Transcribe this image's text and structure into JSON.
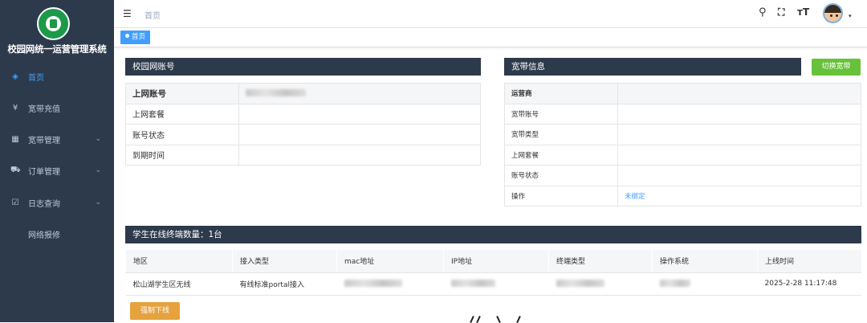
{
  "sidebar": {
    "system_title": "校园网统一运营管理系统",
    "items": [
      {
        "label": "首页",
        "icon": "dashboard-icon",
        "glyph": "◈",
        "active": true,
        "has_arrow": false
      },
      {
        "label": "宽带充值",
        "icon": "yen-icon",
        "glyph": "¥",
        "active": false,
        "has_arrow": false
      },
      {
        "label": "宽带管理",
        "icon": "grid-icon",
        "glyph": "▦",
        "active": false,
        "has_arrow": true
      },
      {
        "label": "订单管理",
        "icon": "cart-icon",
        "glyph": "⛟",
        "active": false,
        "has_arrow": true
      },
      {
        "label": "日志查询",
        "icon": "log-icon",
        "glyph": "☑",
        "active": false,
        "has_arrow": true
      },
      {
        "label": "网络报修",
        "icon": "",
        "glyph": "",
        "active": false,
        "has_arrow": false
      }
    ],
    "arrow": "⌄"
  },
  "topbar": {
    "breadcrumb": "首页",
    "hamburger": "☰",
    "icons": {
      "search": "⚲",
      "fullscreen": "⛶",
      "font_size": "ᴛT"
    },
    "avatar_caret": "▾"
  },
  "tags": {
    "active_tag": "首页"
  },
  "campus_panel": {
    "title": "校园网账号",
    "rows": [
      {
        "label": "上网账号",
        "value_masked": true
      },
      {
        "label": "上网套餐",
        "value": ""
      },
      {
        "label": "账号状态",
        "value": ""
      },
      {
        "label": "到期时间",
        "value": ""
      }
    ]
  },
  "broadband_panel": {
    "title": "宽带信息",
    "switch_button": "切换宽带",
    "rows": [
      {
        "label": "运营商",
        "value": ""
      },
      {
        "label": "宽带账号",
        "value": ""
      },
      {
        "label": "宽带类型",
        "value": ""
      },
      {
        "label": "上网套餐",
        "value": ""
      },
      {
        "label": "账号状态",
        "value": ""
      },
      {
        "label": "操作",
        "value": "未绑定"
      }
    ]
  },
  "terminals": {
    "title": "学生在线终端数量：1台",
    "columns": [
      "地区",
      "接入类型",
      "mac地址",
      "IP地址",
      "终端类型",
      "操作系统",
      "上线时间"
    ],
    "rows": [
      {
        "region": "松山湖学生区无线",
        "access_type": "有线标准portal接入",
        "online_time": "2025-2-28 11:17:48"
      }
    ],
    "force_offline_button": "强制下线"
  },
  "colors": {
    "sidebar_bg": "#2d3a4b",
    "accent": "#409eff",
    "success": "#67c23a",
    "warning": "#e6a23c"
  }
}
